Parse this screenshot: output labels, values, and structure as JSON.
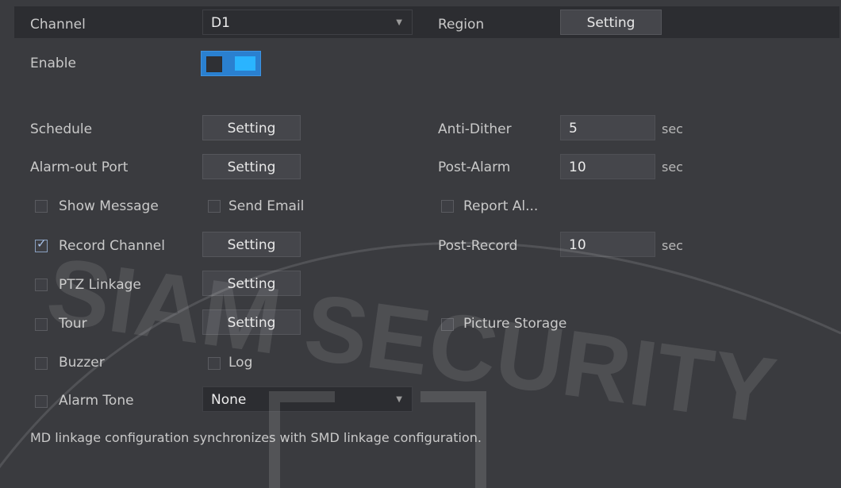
{
  "header": {
    "channel_label": "Channel",
    "channel_value": "D1",
    "region_label": "Region",
    "region_button": "Setting"
  },
  "enable": {
    "label": "Enable",
    "on": true
  },
  "schedule": {
    "label": "Schedule",
    "button": "Setting"
  },
  "alarm_out": {
    "label": "Alarm-out Port",
    "button": "Setting"
  },
  "anti_dither": {
    "label": "Anti-Dither",
    "value": "5",
    "unit": "sec"
  },
  "post_alarm": {
    "label": "Post-Alarm",
    "value": "10",
    "unit": "sec"
  },
  "show_message": {
    "label": "Show Message",
    "checked": false
  },
  "send_email": {
    "label": "Send Email",
    "checked": false
  },
  "report_alarm": {
    "label": "Report Al...",
    "checked": false
  },
  "record_channel": {
    "label": "Record Channel",
    "checked": true,
    "button": "Setting"
  },
  "post_record": {
    "label": "Post-Record",
    "value": "10",
    "unit": "sec"
  },
  "ptz_linkage": {
    "label": "PTZ Linkage",
    "checked": false,
    "button": "Setting"
  },
  "tour": {
    "label": "Tour",
    "checked": false,
    "button": "Setting"
  },
  "picture_storage": {
    "label": "Picture Storage",
    "checked": false
  },
  "buzzer": {
    "label": "Buzzer",
    "checked": false
  },
  "log": {
    "label": "Log",
    "checked": false
  },
  "alarm_tone": {
    "label": "Alarm Tone",
    "checked": false,
    "value": "None"
  },
  "footer_note": "MD linkage configuration synchronizes with SMD linkage configuration.",
  "watermark_text": "SIAM SECURITY",
  "colors": {
    "background": "#3a3b3f",
    "accent": "#2ab4ff",
    "button": "#45464b"
  }
}
